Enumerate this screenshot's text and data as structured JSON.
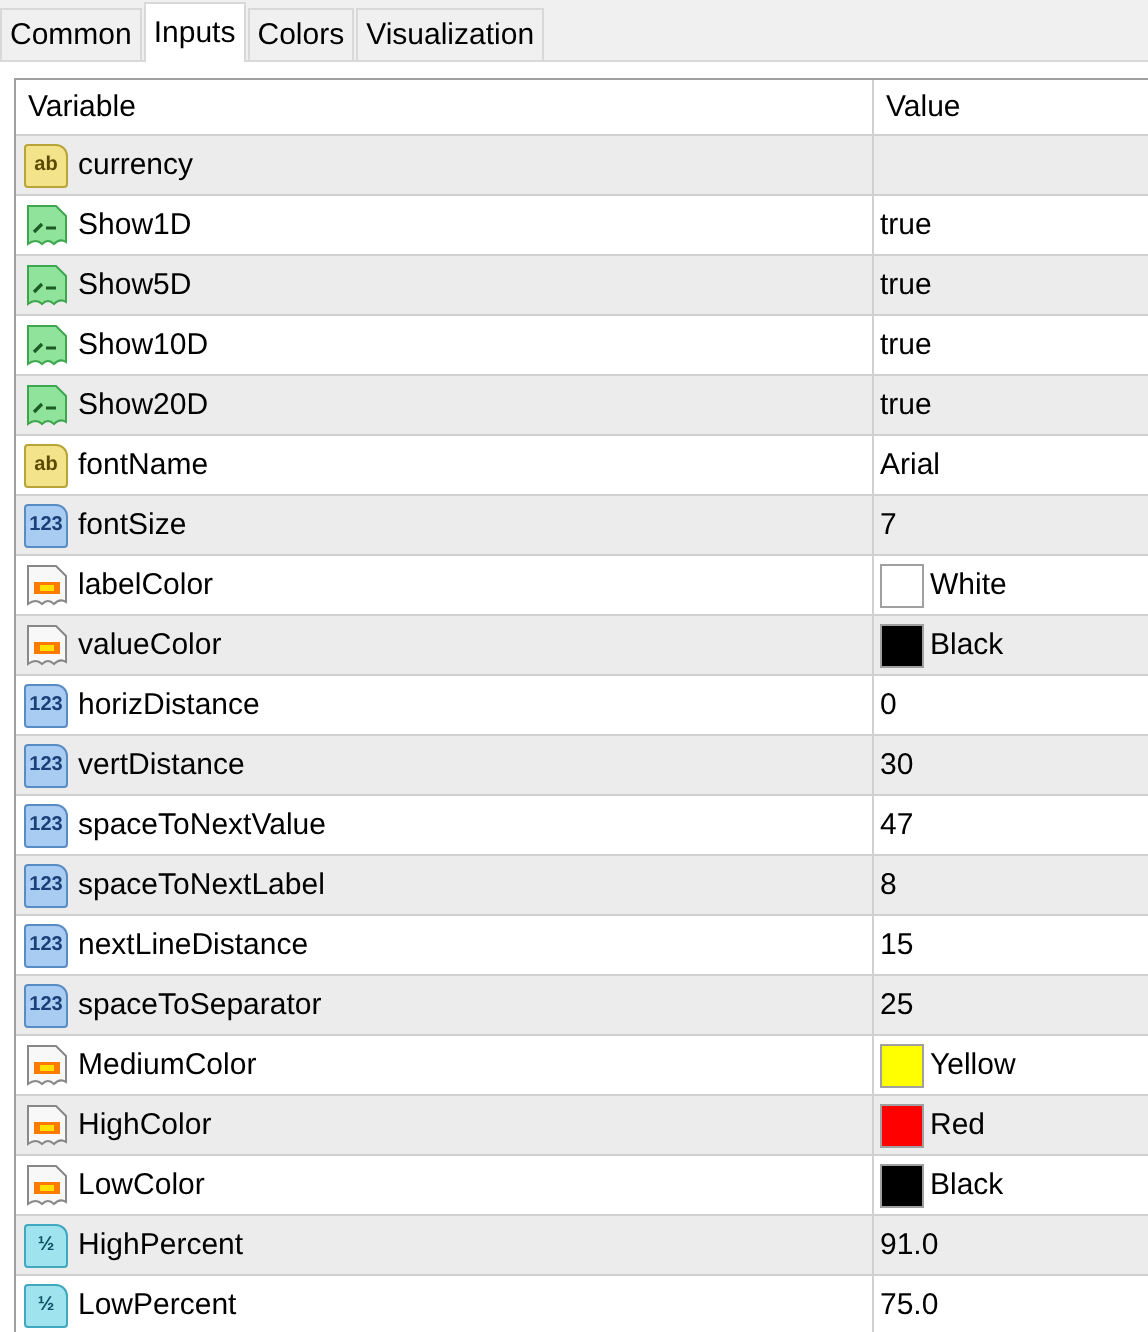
{
  "tabs": [
    {
      "label": "Common",
      "selected": false
    },
    {
      "label": "Inputs",
      "selected": true
    },
    {
      "label": "Colors",
      "selected": false
    },
    {
      "label": "Visualization",
      "selected": false
    }
  ],
  "table": {
    "columns": [
      "Variable",
      "Value"
    ],
    "rows": [
      {
        "kind": "string",
        "icon_text": "ab",
        "name": "currency",
        "value": ""
      },
      {
        "kind": "bool",
        "name": "Show1D",
        "value": "true"
      },
      {
        "kind": "bool",
        "name": "Show5D",
        "value": "true"
      },
      {
        "kind": "bool",
        "name": "Show10D",
        "value": "true"
      },
      {
        "kind": "bool",
        "name": "Show20D",
        "value": "true"
      },
      {
        "kind": "string",
        "icon_text": "ab",
        "name": "fontName",
        "value": "Arial"
      },
      {
        "kind": "int",
        "icon_text": "123",
        "name": "fontSize",
        "value": "7"
      },
      {
        "kind": "color",
        "name": "labelColor",
        "value": "White",
        "color": "#ffffff"
      },
      {
        "kind": "color",
        "name": "valueColor",
        "value": "Black",
        "color": "#000000"
      },
      {
        "kind": "int",
        "icon_text": "123",
        "name": "horizDistance",
        "value": "0"
      },
      {
        "kind": "int",
        "icon_text": "123",
        "name": "vertDistance",
        "value": "30"
      },
      {
        "kind": "int",
        "icon_text": "123",
        "name": "spaceToNextValue",
        "value": "47"
      },
      {
        "kind": "int",
        "icon_text": "123",
        "name": "spaceToNextLabel",
        "value": "8"
      },
      {
        "kind": "int",
        "icon_text": "123",
        "name": "nextLineDistance",
        "value": "15"
      },
      {
        "kind": "int",
        "icon_text": "123",
        "name": "spaceToSeparator",
        "value": "25"
      },
      {
        "kind": "color",
        "name": "MediumColor",
        "value": "Yellow",
        "color": "#ffff00"
      },
      {
        "kind": "color",
        "name": "HighColor",
        "value": "Red",
        "color": "#ff0000"
      },
      {
        "kind": "color",
        "name": "LowColor",
        "value": "Black",
        "color": "#000000"
      },
      {
        "kind": "double",
        "icon_text": "½",
        "name": "HighPercent",
        "value": "91.0"
      },
      {
        "kind": "double",
        "icon_text": "½",
        "name": "LowPercent",
        "value": "75.0"
      }
    ]
  }
}
